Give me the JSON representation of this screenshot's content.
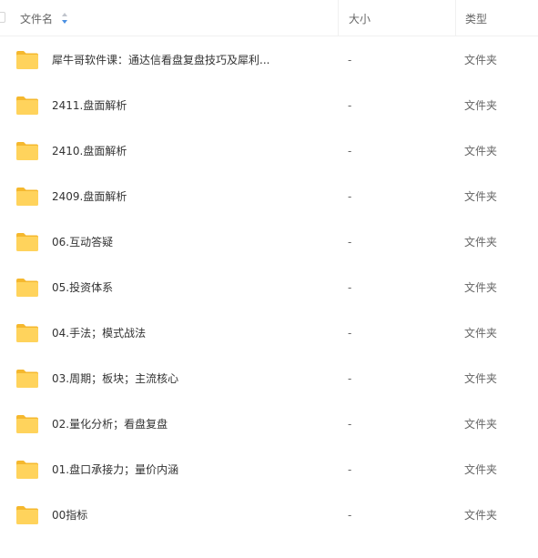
{
  "header": {
    "name_label": "文件名",
    "size_label": "大小",
    "type_label": "类型",
    "sort_icon": "sort-arrows-icon",
    "sort_colors": {
      "up": "#c0c4cc",
      "down": "#4a90e2"
    }
  },
  "folder_icon": {
    "name": "folder-icon",
    "body_color": "#ffd35c",
    "tab_color": "#f5b82e"
  },
  "rows": [
    {
      "name": "犀牛哥软件课：通达信看盘复盘技巧及犀利...",
      "size": "-",
      "type": "文件夹"
    },
    {
      "name": "2411.盘面解析",
      "size": "-",
      "type": "文件夹"
    },
    {
      "name": "2410.盘面解析",
      "size": "-",
      "type": "文件夹"
    },
    {
      "name": "2409.盘面解析",
      "size": "-",
      "type": "文件夹"
    },
    {
      "name": "06.互动答疑",
      "size": "-",
      "type": "文件夹"
    },
    {
      "name": "05.投资体系",
      "size": "-",
      "type": "文件夹"
    },
    {
      "name": "04.手法；模式战法",
      "size": "-",
      "type": "文件夹"
    },
    {
      "name": "03.周期；板块；主流核心",
      "size": "-",
      "type": "文件夹"
    },
    {
      "name": "02.量化分析；看盘复盘",
      "size": "-",
      "type": "文件夹"
    },
    {
      "name": "01.盘口承接力；量价内涵",
      "size": "-",
      "type": "文件夹"
    },
    {
      "name": "00指标",
      "size": "-",
      "type": "文件夹"
    }
  ]
}
